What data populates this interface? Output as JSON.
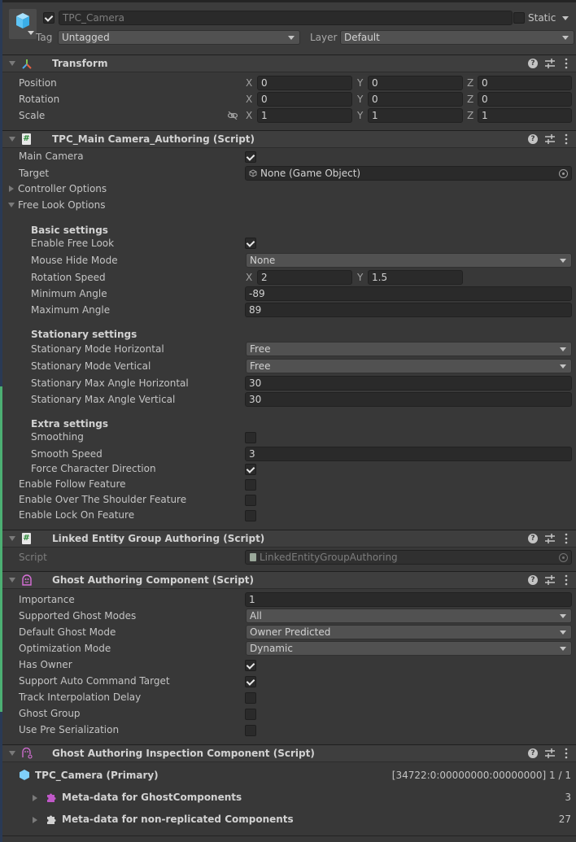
{
  "gameobject": {
    "active": true,
    "name": "TPC_Camera",
    "static_label": "Static",
    "static": false,
    "tag_label": "Tag",
    "tag_value": "Untagged",
    "layer_label": "Layer",
    "layer_value": "Default"
  },
  "transform": {
    "title": "Transform",
    "axis": {
      "x": "X",
      "y": "Y",
      "z": "Z"
    },
    "rows": [
      {
        "label": "Position",
        "x": "0",
        "y": "0",
        "z": "0"
      },
      {
        "label": "Rotation",
        "x": "0",
        "y": "0",
        "z": "0"
      },
      {
        "label": "Scale",
        "x": "1",
        "y": "1",
        "z": "1"
      }
    ]
  },
  "camera_authoring": {
    "title": "TPC_Main Camera_Authoring (Script)",
    "main_camera": {
      "label": "Main Camera",
      "checked": true
    },
    "target": {
      "label": "Target",
      "value": "None (Game Object)"
    },
    "controller_options": {
      "label": "Controller Options",
      "expanded": false
    },
    "free_look_options": {
      "label": "Free Look Options",
      "expanded": true
    },
    "basic": {
      "header": "Basic settings",
      "enable_free_look": {
        "label": "Enable Free Look",
        "checked": true
      },
      "mouse_hide_mode": {
        "label": "Mouse Hide Mode",
        "value": "None"
      },
      "rotation_speed": {
        "label": "Rotation Speed",
        "x_label": "X",
        "x": "2",
        "y_label": "Y",
        "y": "1.5"
      },
      "minimum_angle": {
        "label": "Minimum Angle",
        "value": "-89"
      },
      "maximum_angle": {
        "label": "Maximum Angle",
        "value": "89"
      }
    },
    "stationary": {
      "header": "Stationary settings",
      "mode_horizontal": {
        "label": "Stationary Mode Horizontal",
        "value": "Free"
      },
      "mode_vertical": {
        "label": "Stationary Mode Vertical",
        "value": "Free"
      },
      "max_angle_horizontal": {
        "label": "Stationary Max Angle Horizontal",
        "value": "30"
      },
      "max_angle_vertical": {
        "label": "Stationary Max Angle Vertical",
        "value": "30"
      }
    },
    "extra": {
      "header": "Extra settings",
      "smoothing": {
        "label": "Smoothing",
        "checked": false
      },
      "smooth_speed": {
        "label": "Smooth Speed",
        "value": "3"
      },
      "force_character_direction": {
        "label": "Force Character Direction",
        "checked": true
      }
    },
    "enable_follow": {
      "label": "Enable Follow Feature",
      "checked": false
    },
    "enable_over_shoulder": {
      "label": "Enable Over The Shoulder Feature",
      "checked": false
    },
    "enable_lock_on": {
      "label": "Enable Lock On Feature",
      "checked": false
    }
  },
  "linked_entity": {
    "title": "Linked Entity Group Authoring (Script)",
    "script_label": "Script",
    "script_value": "LinkedEntityGroupAuthoring"
  },
  "ghost_authoring": {
    "title": "Ghost Authoring Component (Script)",
    "importance": {
      "label": "Importance",
      "value": "1"
    },
    "supported_ghost_modes": {
      "label": "Supported Ghost Modes",
      "value": "All"
    },
    "default_ghost_mode": {
      "label": "Default Ghost Mode",
      "value": "Owner Predicted"
    },
    "optimization_mode": {
      "label": "Optimization Mode",
      "value": "Dynamic"
    },
    "has_owner": {
      "label": "Has Owner",
      "checked": true
    },
    "support_auto_command_target": {
      "label": "Support Auto Command Target",
      "checked": true
    },
    "track_interpolation_delay": {
      "label": "Track Interpolation Delay",
      "checked": false
    },
    "ghost_group": {
      "label": "Ghost Group",
      "checked": false
    },
    "use_pre_serialization": {
      "label": "Use Pre Serialization",
      "checked": false
    }
  },
  "ghost_inspection": {
    "title": "Ghost Authoring Inspection Component (Script)",
    "entity_label": "TPC_Camera (Primary)",
    "entity_info": "[34722:0:00000000:00000000] 1 / 1",
    "rows": [
      {
        "label": "Meta-data for GhostComponents",
        "count": "3",
        "color": "#c058c8"
      },
      {
        "label": "Meta-data for non-replicated Components",
        "count": "27",
        "color": "#d0d0d0"
      }
    ]
  },
  "colors": {
    "accent_cube": "#5ec4f5",
    "ghost_icon": "#d86fd8",
    "script_green": "#2e8b3a"
  }
}
